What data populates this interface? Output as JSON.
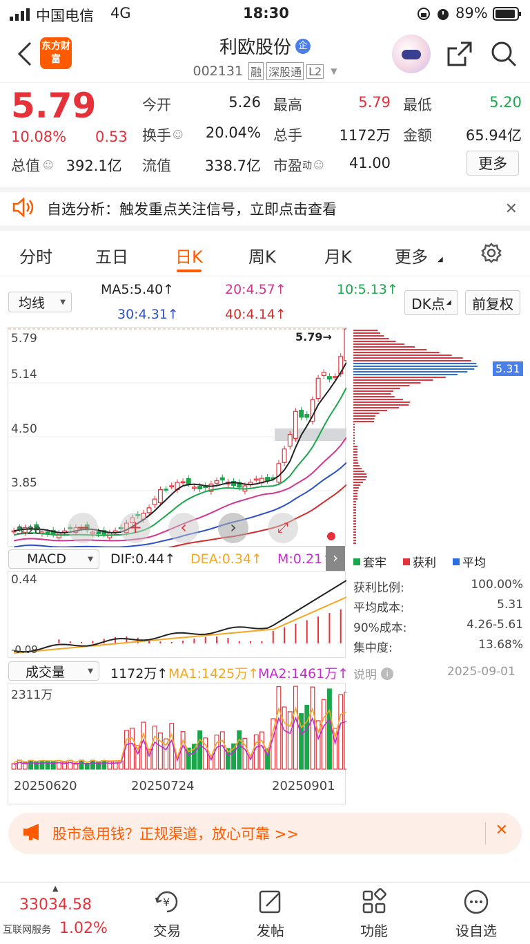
{
  "status_bar": {
    "carrier": "中国电信",
    "network": "4G",
    "time": "18:30",
    "battery": "89%"
  },
  "header": {
    "logo_text": "东方财富",
    "stock_name": "利欧股份",
    "badge": "企",
    "code": "002131",
    "tag_rong": "融",
    "tag_sgt": "深股通",
    "tag_l2": "L2"
  },
  "quote": {
    "price": "5.79",
    "change_pct": "10.08%",
    "change_amt": "0.53",
    "open_label": "今开",
    "open": "5.26",
    "high_label": "最高",
    "high": "5.79",
    "low_label": "最低",
    "low": "5.20",
    "turnover_label": "换手",
    "turnover": "20.04%",
    "volume_label": "总手",
    "volume": "1172万",
    "amount_label": "金额",
    "amount": "65.94亿",
    "mktcap_label": "总值",
    "mktcap": "392.1亿",
    "float_label": "流值",
    "float": "338.7亿",
    "pe_label": "市盈",
    "pe_sup": "动",
    "pe": "41.00",
    "more_btn": "更多"
  },
  "notice": {
    "text": "自选分析：触发重点关注信号，立即点击查看"
  },
  "tabs": [
    "分时",
    "五日",
    "日K",
    "周K",
    "月K",
    "更多"
  ],
  "active_tab": "日K",
  "ma_bar": {
    "select": "均线",
    "ma5": "MA5:5.40↑",
    "ma20": "20:4.57↑",
    "ma10": "10:5.13↑",
    "ma30": "30:4.31↑",
    "ma40": "40:4.14↑",
    "dk_btn": "DK点",
    "adj_btn": "前复权"
  },
  "kline": {
    "y_labels": [
      "5.79",
      "5.14",
      "4.50",
      "3.85"
    ],
    "low_label": "3.20",
    "price_marker": "5.79→",
    "cost_marker": "5.31"
  },
  "macd": {
    "select": "MACD",
    "dif": "DIF:0.44↑",
    "dea": "DEA:0.34↑",
    "m": "M:0.21↑",
    "top": "0.44",
    "bottom": "-0.09"
  },
  "volume": {
    "select": "成交量",
    "vol": "1172万↑",
    "ma1": "MA1:1425万↑",
    "ma2": "MA2:1461万↑",
    "top": "2311万",
    "dates": [
      "20250620",
      "20250724",
      "20250901"
    ]
  },
  "chip": {
    "legend": [
      "套牢",
      "获利",
      "平均"
    ],
    "rows": [
      {
        "label": "获利比例:",
        "value": "100.00%"
      },
      {
        "label": "平均成本:",
        "value": "5.31"
      },
      {
        "label": "90%成本:",
        "value": "4.26-5.61"
      },
      {
        "label": "集中度:",
        "value": "13.68%"
      }
    ],
    "explain": "说明",
    "date": "2025-09-01"
  },
  "ad": {
    "text": "股市急用钱？正规渠道，放心可靠 >>"
  },
  "bottom": {
    "index_value": "33034.58",
    "index_pct": "1.02%",
    "index_sub": "互联网服务",
    "nav": [
      "交易",
      "发帖",
      "功能",
      "设自选"
    ]
  },
  "colors": {
    "up": "#e5323a",
    "down": "#1aa64b",
    "accent": "#ff5a00"
  }
}
